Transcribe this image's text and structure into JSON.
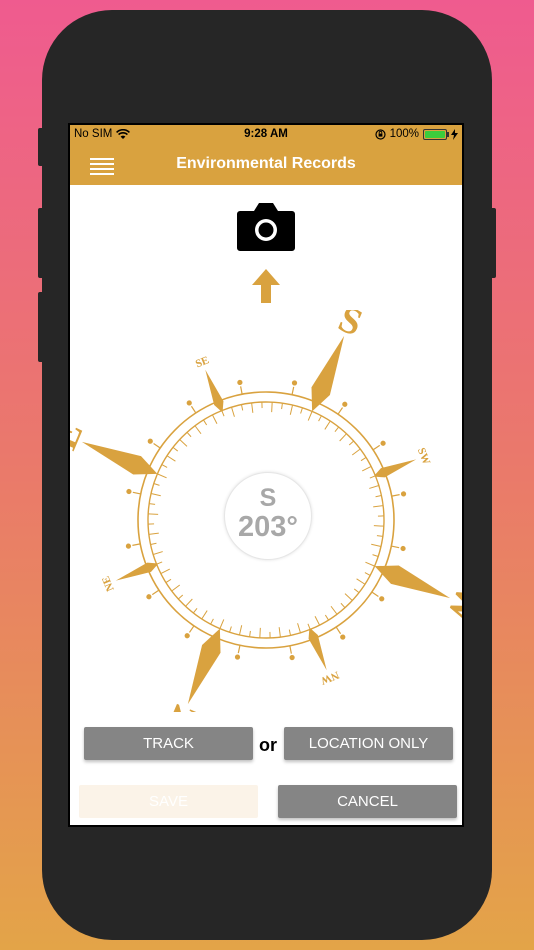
{
  "status_bar": {
    "carrier": "No SIM",
    "time": "9:28 AM",
    "battery_text": "100%",
    "battery_level": 1.0,
    "icons": [
      "wifi-icon",
      "rotation-lock-icon",
      "battery-icon",
      "charging-icon"
    ]
  },
  "navbar": {
    "title": "Environmental Records",
    "menu_icon": "hamburger-menu-icon"
  },
  "camera": {
    "icon": "camera-icon"
  },
  "direction_indicator": {
    "icon": "arrow-up-icon"
  },
  "compass": {
    "heading_direction": "S",
    "heading_degrees": "203°",
    "rotation_degrees": 203,
    "cardinals": {
      "n": "N",
      "e": "E",
      "s": "S",
      "w": "W"
    },
    "intercardinals": {
      "ne": "NE",
      "se": "SE",
      "sw": "SW",
      "nw": "NW"
    }
  },
  "actions": {
    "track_label": "TRACK",
    "or_label": "or",
    "location_only_label": "LOCATION ONLY",
    "save_label": "SAVE",
    "cancel_label": "CANCEL"
  },
  "colors": {
    "accent": "#d9a23f",
    "button_gray": "#858585",
    "heading_text": "#a8a8a8",
    "background_top": "#ef5b8f",
    "background_bottom": "#e3a448"
  }
}
